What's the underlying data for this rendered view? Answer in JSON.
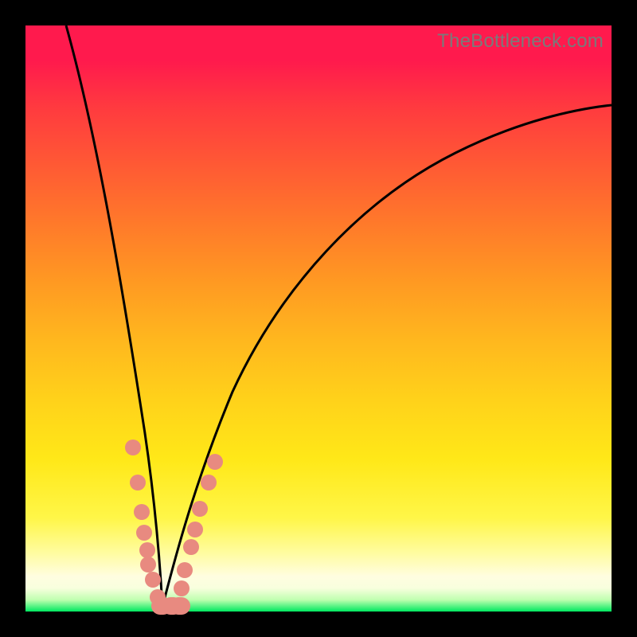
{
  "watermark": "TheBottleneck.com",
  "chart_data": {
    "type": "line",
    "title": "",
    "xlabel": "",
    "ylabel": "",
    "xlim": [
      0,
      100
    ],
    "ylim": [
      0,
      100
    ],
    "background_gradient": {
      "top": "#ff1a4d",
      "middle": "#ffd21a",
      "bottom": "#00e860"
    },
    "series": [
      {
        "name": "left-branch",
        "x": [
          7,
          10,
          13,
          15,
          17,
          18.5,
          19.8,
          20.8,
          21.6,
          22.2,
          22.7,
          23.1,
          23.4
        ],
        "y": [
          100,
          85,
          70,
          56,
          42,
          30,
          20,
          13,
          8,
          5,
          3,
          1.5,
          0.5
        ]
      },
      {
        "name": "right-branch",
        "x": [
          23.4,
          24.5,
          26,
          28,
          31,
          35,
          40,
          46,
          53,
          61,
          70,
          80,
          91,
          100
        ],
        "y": [
          0.5,
          2,
          5,
          10,
          18,
          28,
          38,
          48,
          57,
          65,
          72,
          78,
          82.5,
          85
        ]
      }
    ],
    "scatter_points": {
      "name": "highlighted-points",
      "comment": "salmon dots clustered near the valley",
      "points": [
        {
          "x": 18.3,
          "y": 28
        },
        {
          "x": 19.2,
          "y": 22
        },
        {
          "x": 19.8,
          "y": 17
        },
        {
          "x": 20.3,
          "y": 13.5
        },
        {
          "x": 20.8,
          "y": 10.5
        },
        {
          "x": 20.9,
          "y": 8
        },
        {
          "x": 21.7,
          "y": 5.5
        },
        {
          "x": 22.5,
          "y": 2.5
        },
        {
          "x": 23.2,
          "y": 1,
          "big": true
        },
        {
          "x": 25.0,
          "y": 1,
          "big": true
        },
        {
          "x": 26.3,
          "y": 1,
          "big": true
        },
        {
          "x": 26.6,
          "y": 4
        },
        {
          "x": 27.2,
          "y": 7
        },
        {
          "x": 28.2,
          "y": 11
        },
        {
          "x": 29.0,
          "y": 14
        },
        {
          "x": 29.8,
          "y": 17.5
        },
        {
          "x": 31.3,
          "y": 22
        },
        {
          "x": 32.3,
          "y": 25.5
        }
      ]
    }
  }
}
